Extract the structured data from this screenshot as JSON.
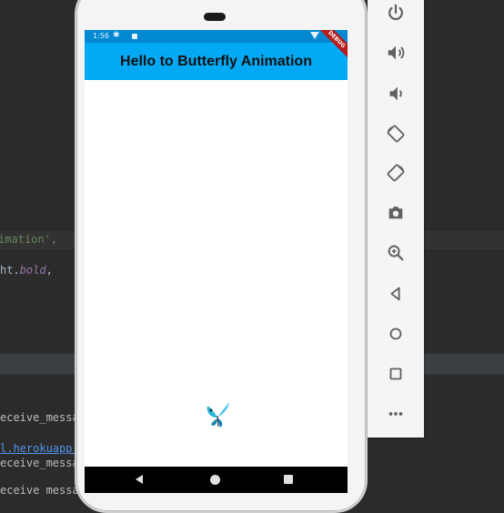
{
  "ide": {
    "line_top": "",
    "line_string": "imation',",
    "line_bold_prefix": "ht.",
    "line_bold_word": "bold",
    "line_bold_suffix": ",",
    "console_1": "eceive_messa",
    "console_link": "l.herokuapp.",
    "console_2": "eceive_messa",
    "console_3": "eceive messa"
  },
  "statusbar": {
    "time": "1:56"
  },
  "appbar": {
    "title": "Hello to Butterfly Animation"
  },
  "debug_banner": "DEBUG",
  "toolbar": {
    "icons": [
      "power-icon",
      "volume-up-icon",
      "volume-down-icon",
      "rotate-left-icon",
      "rotate-right-icon",
      "camera-icon",
      "zoom-icon",
      "back-icon",
      "home-icon",
      "overview-icon",
      "more-icon"
    ]
  },
  "colors": {
    "status_bar": "#0288d1",
    "app_bar": "#03a9f4",
    "butterfly": "#29b6d6",
    "toolbar_icon": "#616161"
  }
}
